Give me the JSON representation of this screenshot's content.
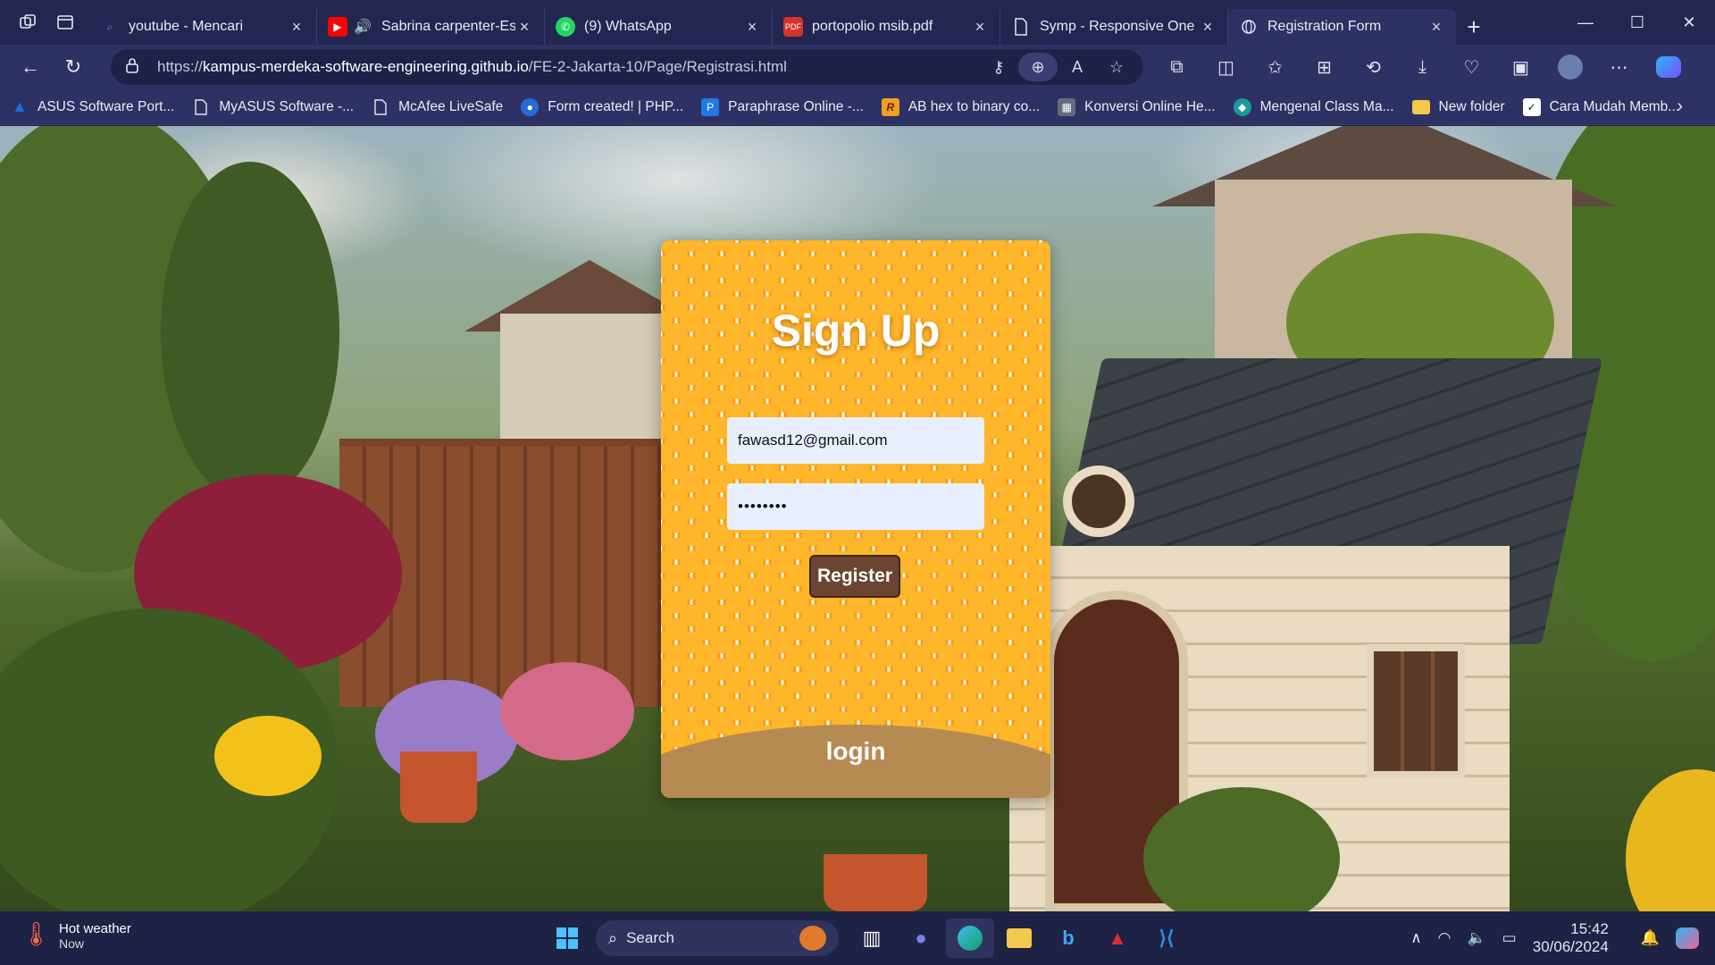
{
  "browser": {
    "tabs": [
      {
        "title": "youtube - Mencari",
        "icon": "search-icon",
        "color": "#2b2f6a"
      },
      {
        "title": "Sabrina carpenter-Esp",
        "icon": "youtube-icon",
        "color": "#ff0000"
      },
      {
        "title": "(9) WhatsApp",
        "icon": "whatsapp-icon",
        "color": "#25d366"
      },
      {
        "title": "portopolio msib.pdf",
        "icon": "pdf-icon",
        "color": "#d4322c"
      },
      {
        "title": "Symp - Responsive One Pa",
        "icon": "page-icon",
        "color": "#2b2f6a"
      },
      {
        "title": "Registration Form",
        "icon": "globe-icon",
        "color": "#2b2f6a"
      }
    ],
    "new_tab_symbol": "+",
    "url_prefix": "https://",
    "url_host": "kampus-merdeka-software-engineering.github.io",
    "url_path": "/FE-2-Jakarta-10/Page/Registrasi.html",
    "bookmarks": [
      {
        "label": "ASUS Software Port...",
        "icon": "asus-icon",
        "color": "#1f6fe0"
      },
      {
        "label": "MyASUS Software -...",
        "icon": "page-icon",
        "color": "transparent"
      },
      {
        "label": "McAfee LiveSafe",
        "icon": "page-icon",
        "color": "transparent"
      },
      {
        "label": "Form created! | PHP...",
        "icon": "form-icon",
        "color": "#2a6ad8"
      },
      {
        "label": "Paraphrase Online -...",
        "icon": "paraphrase-icon",
        "color": "#1e7be6"
      },
      {
        "label": "AB hex to binary co...",
        "icon": "r-icon",
        "color": "#f0a020"
      },
      {
        "label": "Konversi Online He...",
        "icon": "converter-icon",
        "color": "#666a80"
      },
      {
        "label": "Mengenal Class Ma...",
        "icon": "teal-icon",
        "color": "#1a9a9a"
      },
      {
        "label": "New folder",
        "icon": "folder-icon",
        "color": "#f2c94c"
      },
      {
        "label": "Cara Mudah Memb...",
        "icon": "bookmark-icon",
        "color": "#ffffff"
      }
    ]
  },
  "form": {
    "title": "Sign Up",
    "email_value": "fawasd12@gmail.com",
    "password_value": "••••••••",
    "register_label": "Register",
    "login_label": "login"
  },
  "taskbar": {
    "weather_title": "Hot weather",
    "weather_sub": "Now",
    "search_label": "Search",
    "time": "15:42",
    "date": "30/06/2024"
  }
}
